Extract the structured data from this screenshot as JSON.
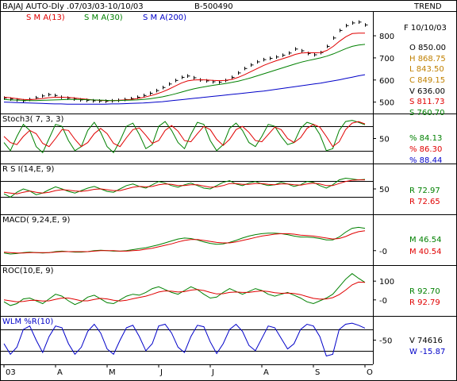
{
  "header": {
    "title": "BAJAJ AUTO-Dly .07/03/03-10/10/03",
    "code": "B-500490",
    "trend_label": "TREND",
    "sma13_label": "S M A(13)",
    "sma30_label": "S M A(30)",
    "sma200_label": "S M A(200)"
  },
  "colors": {
    "price": "#000000",
    "sma13": "#e00000",
    "sma30": "#008000",
    "sma200": "#0000c8",
    "ind_fast": "#008000",
    "ind_slow": "#e00000",
    "wlm": "#0000c8"
  },
  "readout": {
    "date": "F 10/10/03",
    "open": "O  850.00",
    "high": "H  868.75",
    "low": "L  843.50",
    "close": "C  849.15",
    "volume": "V  636.00",
    "sma13": "S  811.73",
    "sma30": "S  760.70"
  },
  "chart_data": [
    {
      "type": "line",
      "title": "BAJAJ AUTO-Dly .07/03/03-10/10/03",
      "ylim": [
        470,
        890
      ],
      "y_ticks": [
        "800",
        "700",
        "600",
        "500"
      ],
      "x_labels": [
        "03",
        "A",
        "M",
        "J",
        "J",
        "A",
        "S",
        "O"
      ],
      "series": [
        {
          "name": "Price",
          "values": [
            518,
            514,
            510,
            506,
            512,
            520,
            528,
            534,
            530,
            522,
            518,
            514,
            510,
            508,
            506,
            505,
            504,
            506,
            508,
            512,
            516,
            522,
            530,
            540,
            552,
            566,
            582,
            598,
            612,
            618,
            610,
            600,
            596,
            592,
            590,
            598,
            612,
            632,
            652,
            668,
            682,
            692,
            698,
            704,
            712,
            722,
            740,
            732,
            720,
            714,
            724,
            752,
            790,
            824,
            846,
            858,
            862,
            849
          ]
        },
        {
          "name": "S M A(13)",
          "values": [
            522,
            520,
            516,
            512,
            511,
            513,
            516,
            520,
            522,
            522,
            521,
            519,
            516,
            513,
            510,
            508,
            507,
            507,
            508,
            510,
            512,
            516,
            521,
            528,
            536,
            546,
            558,
            572,
            586,
            596,
            600,
            601,
            600,
            598,
            597,
            598,
            603,
            612,
            624,
            638,
            652,
            666,
            677,
            687,
            696,
            705,
            716,
            722,
            724,
            723,
            724,
            734,
            752,
            776,
            796,
            810,
            812,
            812
          ]
        },
        {
          "name": "S M A(30)",
          "values": [
            512,
            510,
            509,
            508,
            507,
            507,
            508,
            509,
            510,
            511,
            512,
            512,
            512,
            511,
            510,
            509,
            508,
            507,
            507,
            508,
            509,
            510,
            512,
            515,
            519,
            524,
            530,
            537,
            545,
            553,
            560,
            566,
            571,
            576,
            580,
            584,
            589,
            595,
            602,
            610,
            619,
            628,
            637,
            646,
            655,
            664,
            673,
            681,
            688,
            694,
            700,
            708,
            718,
            730,
            742,
            752,
            758,
            761
          ]
        },
        {
          "name": "S M A(200)",
          "values": [
            500,
            499,
            498,
            497,
            496,
            495,
            494,
            493,
            492,
            492,
            491,
            491,
            491,
            491,
            491,
            491,
            491,
            492,
            492,
            493,
            494,
            495,
            496,
            498,
            500,
            502,
            505,
            508,
            511,
            514,
            517,
            520,
            523,
            526,
            529,
            532,
            535,
            538,
            541,
            544,
            547,
            550,
            554,
            558,
            562,
            566,
            570,
            574,
            578,
            582,
            586,
            591,
            596,
            601,
            607,
            613,
            619,
            624
          ]
        }
      ]
    },
    {
      "type": "line",
      "title": "Stoch3( 7, 3, 3)",
      "ylim": [
        0,
        100
      ],
      "y_ticks": [
        "50"
      ],
      "levels": [
        80,
        20
      ],
      "series": [
        {
          "name": "%K",
          "values": [
            40,
            20,
            55,
            85,
            70,
            30,
            15,
            50,
            85,
            80,
            45,
            20,
            30,
            70,
            90,
            65,
            30,
            15,
            45,
            80,
            88,
            60,
            25,
            35,
            80,
            92,
            70,
            40,
            25,
            60,
            90,
            85,
            45,
            20,
            35,
            75,
            88,
            70,
            40,
            30,
            55,
            85,
            80,
            55,
            35,
            40,
            75,
            90,
            85,
            60,
            20,
            25,
            70,
            92,
            95,
            90,
            84
          ]
        },
        {
          "name": "%D",
          "values": [
            55,
            40,
            35,
            55,
            70,
            62,
            38,
            30,
            50,
            72,
            70,
            48,
            30,
            40,
            62,
            75,
            62,
            38,
            30,
            52,
            72,
            76,
            58,
            38,
            45,
            70,
            82,
            68,
            45,
            42,
            62,
            80,
            72,
            48,
            33,
            48,
            72,
            80,
            65,
            45,
            42,
            60,
            78,
            72,
            50,
            40,
            52,
            75,
            85,
            78,
            55,
            30,
            42,
            72,
            88,
            92,
            86
          ]
        }
      ]
    },
    {
      "type": "line",
      "title": "R S I(14,E, 9)",
      "ylim": [
        0,
        100
      ],
      "y_ticks": [
        "50"
      ],
      "levels": [
        70,
        30
      ],
      "series": [
        {
          "name": "RSI",
          "values": [
            38,
            30,
            42,
            50,
            45,
            36,
            40,
            48,
            55,
            50,
            44,
            40,
            46,
            52,
            56,
            50,
            44,
            42,
            50,
            58,
            62,
            56,
            52,
            60,
            68,
            64,
            58,
            54,
            60,
            64,
            58,
            52,
            50,
            58,
            66,
            70,
            62,
            58,
            64,
            68,
            62,
            58,
            60,
            66,
            62,
            56,
            60,
            68,
            66,
            58,
            52,
            60,
            72,
            76,
            74,
            72,
            73
          ]
        },
        {
          "name": "Signal",
          "values": [
            42,
            40,
            38,
            42,
            45,
            42,
            40,
            42,
            46,
            48,
            47,
            45,
            44,
            46,
            49,
            50,
            48,
            46,
            46,
            50,
            54,
            56,
            55,
            56,
            60,
            62,
            61,
            58,
            58,
            60,
            60,
            57,
            54,
            55,
            58,
            63,
            63,
            61,
            61,
            63,
            63,
            61,
            60,
            62,
            62,
            60,
            59,
            62,
            64,
            62,
            58,
            58,
            63,
            68,
            71,
            72,
            72
          ]
        }
      ]
    },
    {
      "type": "line",
      "title": "MACD( 9,24,E, 9)",
      "ylim": [
        -20,
        65
      ],
      "y_ticks": [
        "-0"
      ],
      "series": [
        {
          "name": "MACD",
          "values": [
            -5,
            -7,
            -6,
            -4,
            -3,
            -4,
            -5,
            -4,
            -2,
            -1,
            -2,
            -3,
            -3,
            -2,
            0,
            1,
            0,
            -1,
            -1,
            0,
            2,
            4,
            6,
            9,
            12,
            16,
            20,
            24,
            26,
            25,
            22,
            18,
            15,
            13,
            14,
            17,
            21,
            26,
            30,
            33,
            35,
            36,
            36,
            35,
            33,
            30,
            28,
            28,
            27,
            25,
            22,
            22,
            28,
            38,
            46,
            48,
            46
          ]
        },
        {
          "name": "Signal",
          "values": [
            -3,
            -4,
            -5,
            -5,
            -4,
            -4,
            -4,
            -4,
            -3,
            -2,
            -2,
            -2,
            -2,
            -2,
            -1,
            0,
            0,
            0,
            -1,
            -1,
            0,
            1,
            3,
            5,
            8,
            11,
            14,
            18,
            21,
            23,
            23,
            21,
            19,
            17,
            16,
            16,
            18,
            21,
            24,
            27,
            30,
            32,
            34,
            35,
            35,
            34,
            32,
            31,
            30,
            28,
            26,
            24,
            25,
            29,
            35,
            39,
            41
          ]
        }
      ]
    },
    {
      "type": "line",
      "title": "ROC(10,E, 9)",
      "ylim": [
        -60,
        160
      ],
      "y_ticks": [
        "100",
        "-0"
      ],
      "series": [
        {
          "name": "ROC",
          "values": [
            -10,
            -30,
            -20,
            5,
            10,
            -5,
            -20,
            5,
            30,
            20,
            -5,
            -25,
            -10,
            15,
            25,
            5,
            -15,
            -20,
            0,
            20,
            30,
            25,
            40,
            60,
            70,
            55,
            40,
            30,
            50,
            70,
            55,
            30,
            10,
            15,
            40,
            60,
            45,
            30,
            45,
            60,
            50,
            30,
            20,
            30,
            40,
            25,
            10,
            -10,
            -20,
            -5,
            10,
            30,
            70,
            110,
            140,
            115,
            93
          ]
        },
        {
          "name": "Signal",
          "values": [
            0,
            -5,
            -10,
            -8,
            -3,
            -2,
            -6,
            -5,
            3,
            10,
            10,
            3,
            -5,
            -5,
            2,
            8,
            5,
            -2,
            -6,
            -2,
            6,
            13,
            20,
            30,
            42,
            48,
            46,
            42,
            44,
            52,
            55,
            50,
            40,
            32,
            33,
            40,
            42,
            40,
            40,
            45,
            48,
            45,
            38,
            35,
            36,
            34,
            28,
            18,
            8,
            4,
            5,
            12,
            28,
            52,
            80,
            95,
            93
          ]
        }
      ]
    },
    {
      "type": "line",
      "title": "WLM %R(10)",
      "ylim": [
        -105,
        5
      ],
      "y_ticks": [
        "-50"
      ],
      "levels": [
        -20,
        -80
      ],
      "series": [
        {
          "name": "%R",
          "values": [
            -60,
            -90,
            -70,
            -20,
            -10,
            -50,
            -85,
            -40,
            -10,
            -15,
            -60,
            -90,
            -70,
            -25,
            -5,
            -30,
            -75,
            -90,
            -50,
            -15,
            -8,
            -40,
            -80,
            -60,
            -10,
            -5,
            -30,
            -70,
            -85,
            -40,
            -8,
            -12,
            -55,
            -88,
            -60,
            -20,
            -5,
            -25,
            -65,
            -80,
            -45,
            -10,
            -15,
            -45,
            -75,
            -60,
            -20,
            -5,
            -10,
            -40,
            -95,
            -90,
            -20,
            -5,
            -2,
            -8,
            -16
          ]
        }
      ]
    }
  ],
  "panels": {
    "stoch": {
      "title": "Stoch3( 7, 3, 3)",
      "r1": "%  84.13",
      "r2": "%  86.30",
      "r3": "%  88.44"
    },
    "rsi": {
      "title": "R S I(14,E, 9)",
      "r1": "R  72.97",
      "r2": "R  72.65"
    },
    "macd": {
      "title": "MACD( 9,24,E, 9)",
      "r1": "M  46.54",
      "r2": "M  40.54"
    },
    "roc": {
      "title": "ROC(10,E, 9)",
      "r1": "R  92.70",
      "r2": "R  92.79"
    },
    "wlm": {
      "title": "WLM %R(10)",
      "r1": "V  74616",
      "r2": "W  -15.87"
    }
  }
}
